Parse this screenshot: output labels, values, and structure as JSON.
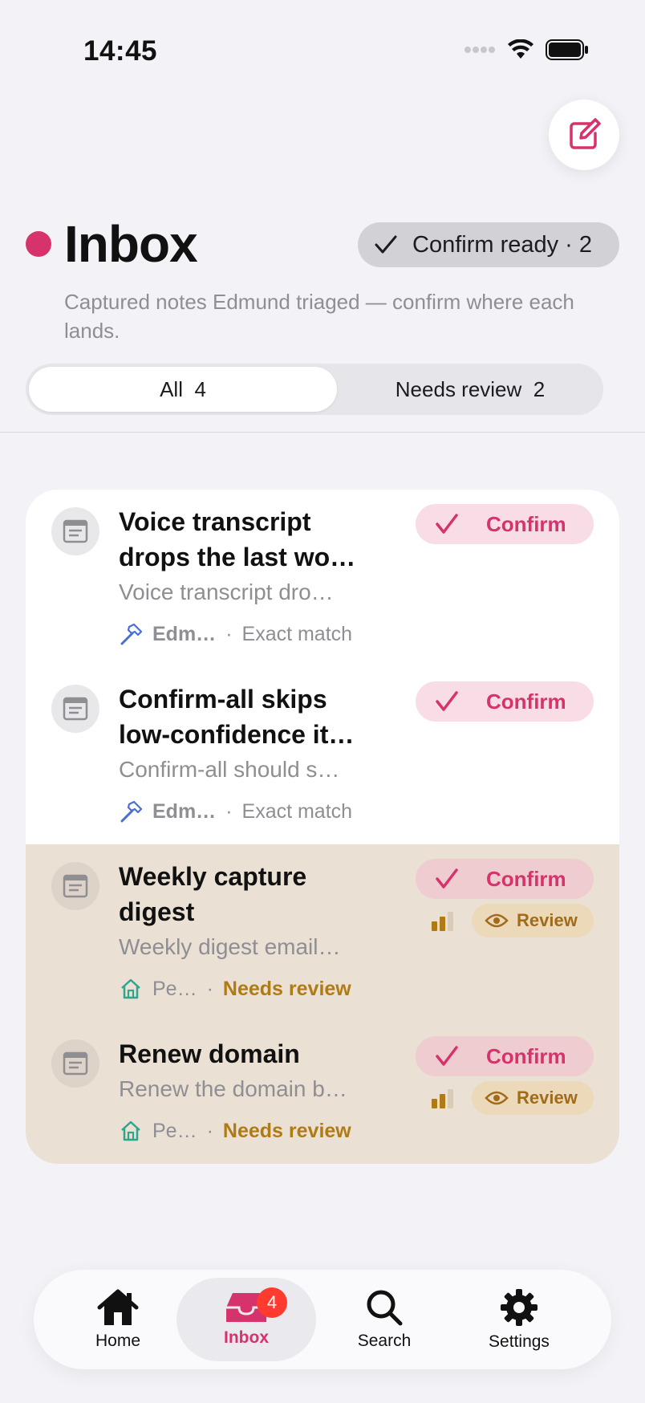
{
  "status_bar": {
    "time": "14:45"
  },
  "header": {
    "title": "Inbox",
    "confirm_ready_label": "Confirm ready · 2",
    "subtitle": "Captured notes Edmund triaged — confirm where each lands."
  },
  "segments": {
    "all_label": "All",
    "all_count": "4",
    "review_label": "Needs review",
    "review_count": "2"
  },
  "items": [
    {
      "title": "Voice transcript drops the last wo…",
      "preview": "Voice transcript dro…",
      "source": "Edm…",
      "source_icon": "hammer-icon",
      "status": "Exact match",
      "needs_review": false,
      "confirm_label": "Confirm"
    },
    {
      "title": "Confirm-all skips low-confidence it…",
      "preview": "Confirm-all should s…",
      "source": "Edm…",
      "source_icon": "hammer-icon",
      "status": "Exact match",
      "needs_review": false,
      "confirm_label": "Confirm"
    },
    {
      "title": "Weekly capture digest",
      "preview": "Weekly digest email…",
      "source": "Pe…",
      "source_icon": "home-icon",
      "status": "Needs review",
      "needs_review": true,
      "confirm_label": "Confirm",
      "review_label": "Review"
    },
    {
      "title": "Renew domain",
      "preview": "Renew the domain b…",
      "source": "Pe…",
      "source_icon": "home-icon",
      "status": "Needs review",
      "needs_review": true,
      "confirm_label": "Confirm",
      "review_label": "Review"
    }
  ],
  "tab_bar": {
    "home_label": "Home",
    "inbox_label": "Inbox",
    "inbox_badge": "4",
    "search_label": "Search",
    "settings_label": "Settings"
  },
  "colors": {
    "accent": "#d6336c",
    "review_bg": "#ebe0d4",
    "warn": "#b07a14",
    "badge": "#ff3b30"
  }
}
